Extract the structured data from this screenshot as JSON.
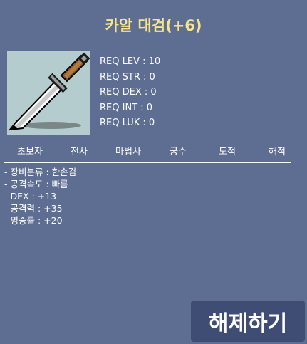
{
  "item": {
    "name": "카알 대검(+6)",
    "icon": "dagger-icon"
  },
  "requirements": [
    {
      "label": "REQ LEV",
      "value": "10"
    },
    {
      "label": "REQ STR",
      "value": "0"
    },
    {
      "label": "REQ DEX",
      "value": "0"
    },
    {
      "label": "REQ INT",
      "value": "0"
    },
    {
      "label": "REQ LUK",
      "value": "0"
    }
  ],
  "jobs": [
    "초보자",
    "전사",
    "마법사",
    "궁수",
    "도적",
    "해적"
  ],
  "stats": [
    "- 장비분류 : 한손검",
    "- 공격속도 : 빠름",
    "- DEX : +13",
    "- 공격력 : +35",
    "- 명중률 : +20"
  ],
  "actions": {
    "unequip_label": "해제하기"
  },
  "colors": {
    "panel_bg": "#5e6d92",
    "title": "#f6e58d",
    "button_bg": "#3f4d75",
    "icon_bg": "#b4cccd"
  }
}
